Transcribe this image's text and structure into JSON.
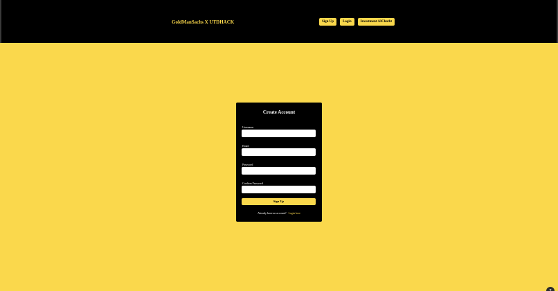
{
  "navbar": {
    "brand": "GoldManSachs X UTDHACK",
    "buttons": [
      "Sign Up",
      "Login",
      "Investment AIChatbt"
    ]
  },
  "form": {
    "title": "Create Account",
    "fields": [
      {
        "label": "Username",
        "value": ""
      },
      {
        "label": "Email",
        "value": ""
      },
      {
        "label": "Password",
        "value": ""
      },
      {
        "label": "Confirm Password",
        "value": ""
      }
    ],
    "submit_label": "Sign Up",
    "footer_text": "Already have an account?",
    "footer_link": "Login here"
  },
  "colors": {
    "accent": "#fad84c",
    "dark": "#000000",
    "input_bg": "#ffffff"
  },
  "icons": {
    "corner": "help-icon"
  }
}
